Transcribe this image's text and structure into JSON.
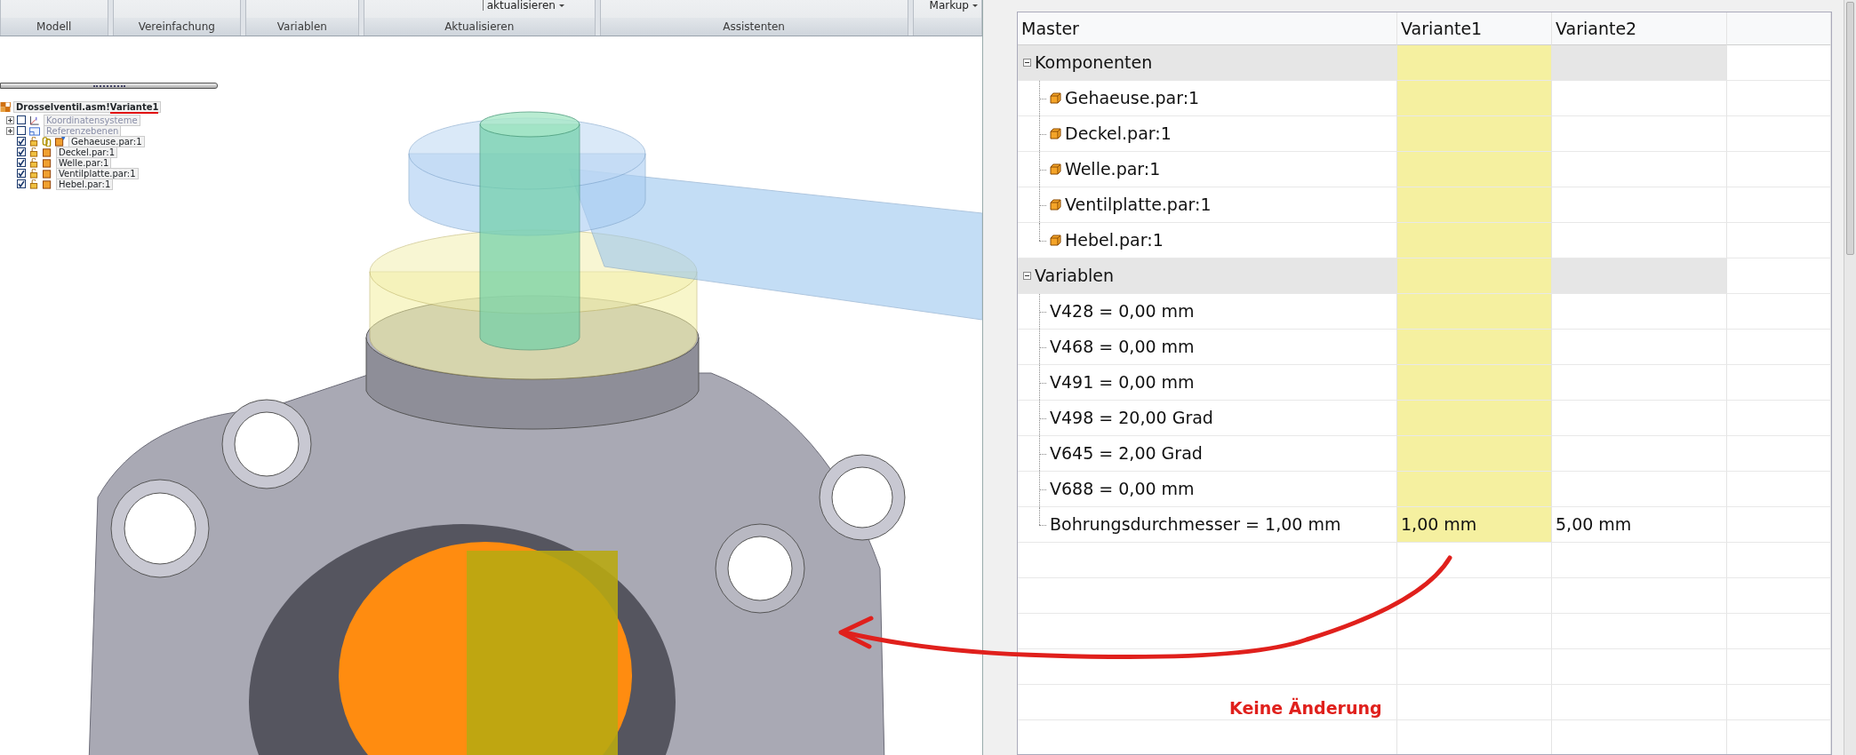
{
  "ribbon": {
    "groups": [
      {
        "label": "Modell"
      },
      {
        "label": "Vereinfachung"
      },
      {
        "label": "Variablen"
      },
      {
        "label": "Aktualisieren",
        "buttons": [
          {
            "label": "aktualisieren",
            "dropdown": true
          }
        ]
      },
      {
        "label": "Assistenten"
      },
      {
        "buttons": [
          {
            "label": "Markup",
            "dropdown": true
          }
        ]
      }
    ]
  },
  "pathfinder": {
    "root": {
      "document": "Drosselventil.asm!",
      "variant": "Variante1"
    },
    "items": [
      {
        "kind": "coordinate-systems",
        "label": "Koordinatensysteme",
        "expandable": true,
        "checked": false,
        "dimmed": true
      },
      {
        "kind": "reference-planes",
        "label": "Referenzebenen",
        "expandable": true,
        "checked": false,
        "dimmed": true
      },
      {
        "kind": "part",
        "label": "Gehaeuse.par:1",
        "expandable": false,
        "checked": true,
        "dimmed": false,
        "linked": true
      },
      {
        "kind": "part",
        "label": "Deckel.par:1",
        "expandable": false,
        "checked": true,
        "dimmed": false,
        "linked": false
      },
      {
        "kind": "part",
        "label": "Welle.par:1",
        "expandable": false,
        "checked": true,
        "dimmed": false,
        "linked": false
      },
      {
        "kind": "part",
        "label": "Ventilplatte.par:1",
        "expandable": false,
        "checked": true,
        "dimmed": false,
        "linked": false
      },
      {
        "kind": "part",
        "label": "Hebel.par:1",
        "expandable": false,
        "checked": true,
        "dimmed": false,
        "linked": false
      }
    ]
  },
  "variant_table": {
    "columns": [
      {
        "label": "Master",
        "selected": false
      },
      {
        "label": "Variante1",
        "selected": true
      },
      {
        "label": "Variante2",
        "selected": false
      }
    ],
    "groups": [
      {
        "label": "Komponenten",
        "expanded": true,
        "rows": [
          {
            "kind": "part",
            "label": "Gehaeuse.par:1"
          },
          {
            "kind": "part",
            "label": "Deckel.par:1"
          },
          {
            "kind": "part",
            "label": "Welle.par:1"
          },
          {
            "kind": "part",
            "label": "Ventilplatte.par:1"
          },
          {
            "kind": "part",
            "label": "Hebel.par:1"
          }
        ]
      },
      {
        "label": "Variablen",
        "expanded": true,
        "rows": [
          {
            "kind": "variable",
            "label": "V428 = 0,00 mm"
          },
          {
            "kind": "variable",
            "label": "V468 = 0,00 mm"
          },
          {
            "kind": "variable",
            "label": "V491 = 0,00 mm"
          },
          {
            "kind": "variable",
            "label": "V498 = 20,00 Grad"
          },
          {
            "kind": "variable",
            "label": "V645 = 2,00 Grad"
          },
          {
            "kind": "variable",
            "label": "V688 = 0,00 mm"
          },
          {
            "kind": "variable",
            "label": "Bohrungsdurchmesser = 1,00 mm",
            "values": [
              "1,00 mm",
              "5,00 mm"
            ]
          }
        ]
      }
    ]
  },
  "annotation": {
    "text": "Keine Änderung"
  }
}
